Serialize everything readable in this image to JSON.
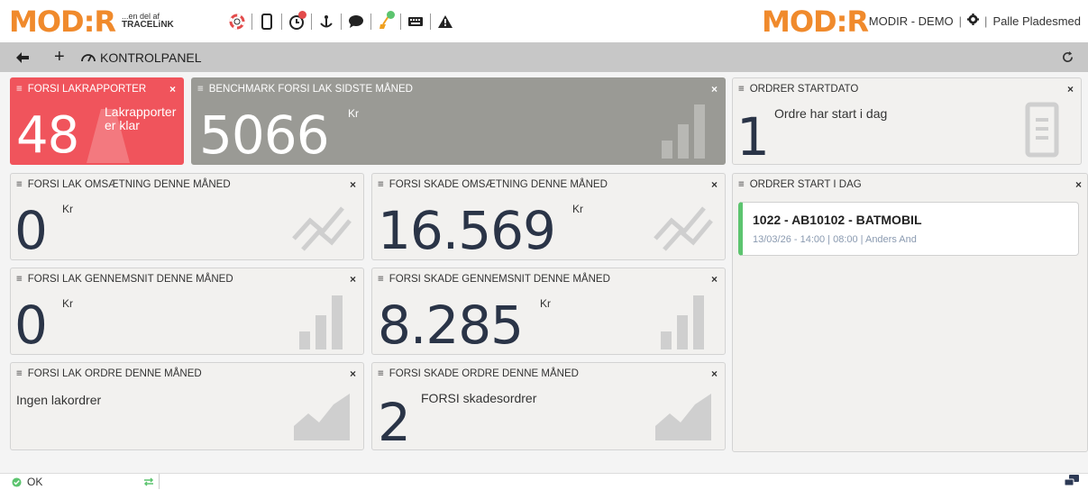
{
  "brand": {
    "logo": "MOD:R",
    "sub1": "...en del af",
    "sub2": "TRACELiNK",
    "right_logo": "MOD:R"
  },
  "header": {
    "company": "MODIR - DEMO",
    "sep": "|",
    "user_sep": "|",
    "user": "Palle Pladesmed"
  },
  "toolbar_icons": [
    "lifebuoy-icon",
    "phone-icon",
    "clock-icon",
    "anchor-icon",
    "chat-icon",
    "broom-icon",
    "keyboard-icon",
    "warning-icon"
  ],
  "nav": {
    "title": "KONTROLPANEL"
  },
  "widgets": {
    "lak_rapporter": {
      "title": "FORSI LAKRAPPORTER",
      "value": "48",
      "text1": "Lakrapporter",
      "text2": "er klar",
      "close": "×"
    },
    "benchmark": {
      "title": "BENCHMARK FORSI LAK SIDSTE MÅNED",
      "value": "5066",
      "unit": "Kr",
      "close": "×"
    },
    "ordrer_startdato": {
      "title": "ORDRER STARTDATO",
      "value": "1",
      "text": "Ordre har start i dag",
      "close": "×"
    },
    "lak_oms": {
      "title": "FORSI LAK OMSÆTNING DENNE MÅNED",
      "value": "0",
      "unit": "Kr",
      "close": "×"
    },
    "skade_oms": {
      "title": "FORSI SKADE OMSÆTNING DENNE MÅNED",
      "value": "16.569",
      "unit": "Kr",
      "close": "×"
    },
    "ordrer_start": {
      "title": "ORDRER START I DAG",
      "close": "×",
      "card": {
        "title": "1022 - AB10102 - BATMOBIL",
        "meta": "13/03/26 - 14:00 | 08:00 | Anders And"
      }
    },
    "lak_gns": {
      "title": "FORSI LAK GENNEMSNIT DENNE MÅNED",
      "value": "0",
      "unit": "Kr",
      "close": "×"
    },
    "skade_gns": {
      "title": "FORSI SKADE GENNEMSNIT DENNE MÅNED",
      "value": "8.285",
      "unit": "Kr",
      "close": "×"
    },
    "lak_ordre": {
      "title": "FORSI LAK ORDRE DENNE MÅNED",
      "text": "Ingen lakordrer",
      "close": "×"
    },
    "skade_ordre": {
      "title": "FORSI SKADE ORDRE DENNE MÅNED",
      "value": "2",
      "text": "FORSI skadesordrer",
      "close": "×"
    }
  },
  "status": {
    "text": "OK"
  },
  "colors": {
    "accent": "#f08a2c",
    "red_panel": "#f0545c",
    "gray_panel": "#9a9a95",
    "success": "#5cc46f"
  }
}
